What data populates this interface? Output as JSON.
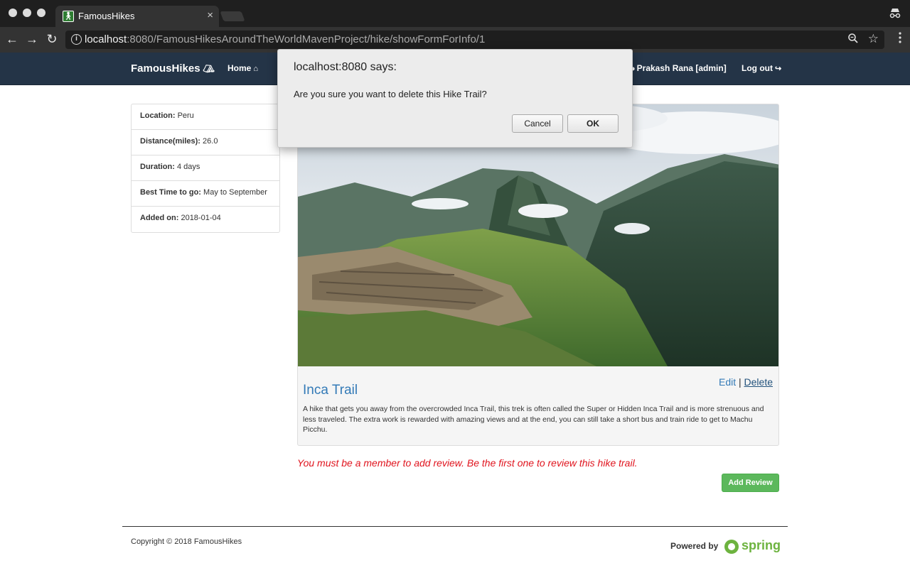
{
  "browser": {
    "tab_title": "FamousHikes",
    "tab_close": "×",
    "url_host": "localhost",
    "url_rest": ":8080/FamousHikesAroundTheWorldMavenProject/hike/showFormForInfo/1"
  },
  "navbar": {
    "brand": "FamousHikes",
    "home": "Home",
    "user": "Prakash Rana [admin]",
    "logout": "Log out"
  },
  "info": [
    {
      "label": "Location:",
      "value": "Peru"
    },
    {
      "label": "Distance(miles):",
      "value": "26.0"
    },
    {
      "label": "Duration:",
      "value": "4 days"
    },
    {
      "label": "Best Time to go:",
      "value": "May to September"
    },
    {
      "label": "Added on:",
      "value": "2018-01-04"
    }
  ],
  "hike": {
    "title": "Inca Trail",
    "edit": "Edit",
    "separator": "|",
    "delete": "Delete",
    "description": "A hike that gets you away from the overcrowded Inca Trail, this trek is often called the Super or Hidden Inca Trail and is more strenuous and less traveled. The extra work is rewarded with amazing views and at the end, you can still take a short bus and train ride to get to Machu Picchu."
  },
  "review": {
    "message": "You must be a member to add review. Be the first one to review this hike trail.",
    "add_button": "Add Review"
  },
  "footer": {
    "copyright": "Copyright © 2018 FamousHikes",
    "powered_by": "Powered by",
    "spring": "spring"
  },
  "dialog": {
    "title": "localhost:8080 says:",
    "message": "Are you sure you want to delete this Hike Trail?",
    "cancel": "Cancel",
    "ok": "OK"
  },
  "colors": {
    "navbar_bg": "#243447",
    "link": "#337ab7",
    "warning_text": "#e0141e",
    "success_button": "#5cb85c",
    "spring_green": "#6db33f"
  }
}
